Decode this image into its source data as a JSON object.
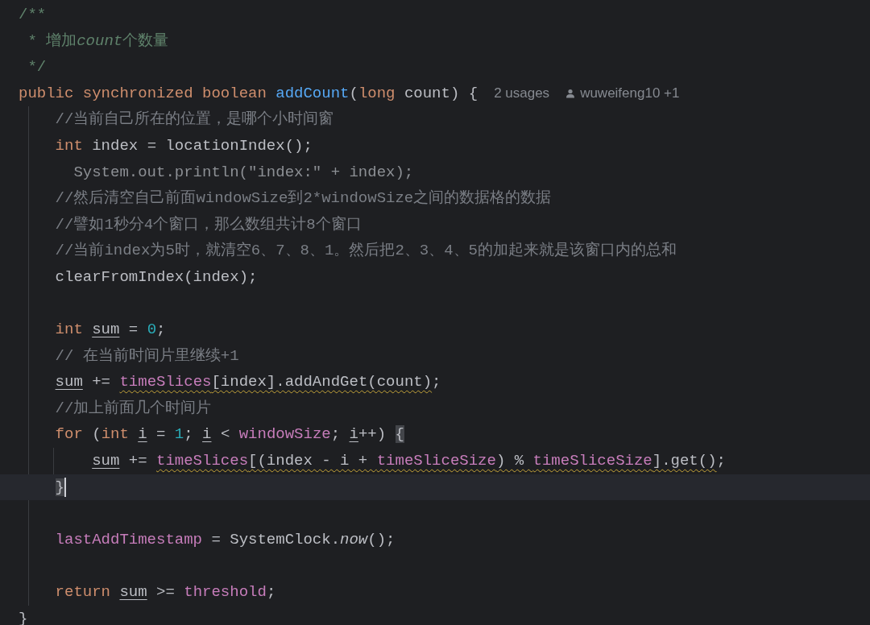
{
  "editor": {
    "lines": [
      {
        "kind": "code",
        "current": false,
        "tokens": [
          {
            "kind": "doc",
            "text": "/**"
          }
        ]
      },
      {
        "kind": "doc_cont",
        "current": false,
        "tokens": [
          {
            "kind": "doc",
            "text": "* 增加"
          },
          {
            "kind": "doc_italic",
            "text": "count"
          },
          {
            "kind": "doc",
            "text": "个数量"
          }
        ]
      },
      {
        "kind": "doc_cont",
        "current": false,
        "tokens": [
          {
            "kind": "doc",
            "text": "*/"
          }
        ]
      },
      {
        "kind": "code",
        "current": false,
        "tokens": [
          {
            "kind": "keyword",
            "text": "public synchronized boolean "
          },
          {
            "kind": "function",
            "text": "addCount"
          },
          {
            "kind": "plain",
            "text": "("
          },
          {
            "kind": "keyword",
            "text": "long"
          },
          {
            "kind": "plain",
            "text": " count) {"
          }
        ],
        "hints": [
          {
            "kind": "usages",
            "text": "2 usages"
          },
          {
            "kind": "author",
            "text": "wuweifeng10 +1"
          }
        ],
        "children": [
          {
            "kind": "code",
            "current": false,
            "tokens": [
              {
                "kind": "comment",
                "text": "//当前自己所在的位置，是哪个小时间窗"
              }
            ]
          },
          {
            "kind": "code",
            "current": false,
            "tokens": [
              {
                "kind": "keyword",
                "text": "int"
              },
              {
                "kind": "plain",
                "text": " index = locationIndex();"
              }
            ]
          },
          {
            "kind": "shifted",
            "current": false,
            "tokens": [
              {
                "kind": "dim",
                "text": "System.out.println(\"index:\" + index);"
              }
            ]
          },
          {
            "kind": "code",
            "current": false,
            "tokens": [
              {
                "kind": "comment",
                "text": "//然后清空自己前面windowSize到2*windowSize之间的数据格的数据"
              }
            ]
          },
          {
            "kind": "code",
            "current": false,
            "tokens": [
              {
                "kind": "comment",
                "text": "//譬如1秒分4个窗口，那么数组共计8个窗口"
              }
            ]
          },
          {
            "kind": "code",
            "current": false,
            "tokens": [
              {
                "kind": "comment",
                "text": "//当前index为5时，就清空6、7、8、1。然后把2、3、4、5的加起来就是该窗口内的总和"
              }
            ]
          },
          {
            "kind": "code",
            "current": false,
            "tokens": [
              {
                "kind": "plain",
                "text": "clearFromIndex(index);"
              }
            ]
          },
          {
            "kind": "blank",
            "current": false
          },
          {
            "kind": "code",
            "current": false,
            "tokens": [
              {
                "kind": "keyword",
                "text": "int "
              },
              {
                "kind": "plain",
                "text": "sum",
                "underlined": true
              },
              {
                "kind": "plain",
                "text": " = "
              },
              {
                "kind": "number",
                "text": "0"
              },
              {
                "kind": "plain",
                "text": ";"
              }
            ]
          },
          {
            "kind": "code",
            "current": false,
            "tokens": [
              {
                "kind": "comment",
                "text": "// 在当前时间片里继续+1"
              }
            ]
          },
          {
            "kind": "code",
            "current": false,
            "tokens": [
              {
                "kind": "plain",
                "text": "sum",
                "underlined": true
              },
              {
                "kind": "plain",
                "text": " += "
              },
              {
                "kind": "field",
                "text": "timeSlices",
                "warning": true
              },
              {
                "kind": "plain",
                "text": "[index].addAndGet(count)",
                "warning": true
              },
              {
                "kind": "plain",
                "text": ";"
              }
            ]
          },
          {
            "kind": "code",
            "current": false,
            "tokens": [
              {
                "kind": "comment",
                "text": "//加上前面几个时间片"
              }
            ]
          },
          {
            "kind": "code",
            "current": false,
            "tokens": [
              {
                "kind": "keyword",
                "text": "for"
              },
              {
                "kind": "plain",
                "text": " ("
              },
              {
                "kind": "keyword",
                "text": "int "
              },
              {
                "kind": "plain",
                "text": "i",
                "underlined": true
              },
              {
                "kind": "plain",
                "text": " = "
              },
              {
                "kind": "number",
                "text": "1"
              },
              {
                "kind": "plain",
                "text": "; "
              },
              {
                "kind": "plain",
                "text": "i",
                "underlined": true
              },
              {
                "kind": "plain",
                "text": " < "
              },
              {
                "kind": "field",
                "text": "windowSize"
              },
              {
                "kind": "plain",
                "text": "; "
              },
              {
                "kind": "plain",
                "text": "i",
                "underlined": true
              },
              {
                "kind": "plain",
                "text": "++) "
              },
              {
                "kind": "plain",
                "text": "{",
                "matched": true
              }
            ],
            "children": [
              {
                "kind": "code",
                "current": false,
                "tokens": [
                  {
                    "kind": "plain",
                    "text": "sum",
                    "underlined": true
                  },
                  {
                    "kind": "plain",
                    "text": " += "
                  },
                  {
                    "kind": "field",
                    "text": "timeSlices",
                    "warning": true
                  },
                  {
                    "kind": "plain",
                    "text": "[(index - i + ",
                    "warning": true
                  },
                  {
                    "kind": "field",
                    "text": "timeSliceSize",
                    "warning": true
                  },
                  {
                    "kind": "plain",
                    "text": ") % ",
                    "warning": true
                  },
                  {
                    "kind": "field",
                    "text": "timeSliceSize",
                    "warning": true
                  },
                  {
                    "kind": "plain",
                    "text": "].get()",
                    "warning": true
                  },
                  {
                    "kind": "plain",
                    "text": ";"
                  }
                ]
              }
            ]
          },
          {
            "kind": "code",
            "current": true,
            "tokens": [
              {
                "kind": "plain",
                "text": "}",
                "matched": true
              }
            ]
          },
          {
            "kind": "blank",
            "current": false
          },
          {
            "kind": "code",
            "current": false,
            "tokens": [
              {
                "kind": "field",
                "text": "lastAddTimestamp"
              },
              {
                "kind": "plain",
                "text": " = SystemClock."
              },
              {
                "kind": "italic",
                "text": "now"
              },
              {
                "kind": "plain",
                "text": "();"
              }
            ]
          },
          {
            "kind": "blank",
            "current": false
          },
          {
            "kind": "code",
            "current": false,
            "tokens": [
              {
                "kind": "keyword",
                "text": "return "
              },
              {
                "kind": "plain",
                "text": "sum",
                "underlined": true
              },
              {
                "kind": "plain",
                "text": " >= "
              },
              {
                "kind": "field",
                "text": "threshold"
              },
              {
                "kind": "plain",
                "text": ";"
              }
            ]
          }
        ]
      },
      {
        "kind": "code",
        "current": false,
        "tokens": [
          {
            "kind": "plain",
            "text": "}"
          }
        ]
      }
    ]
  }
}
